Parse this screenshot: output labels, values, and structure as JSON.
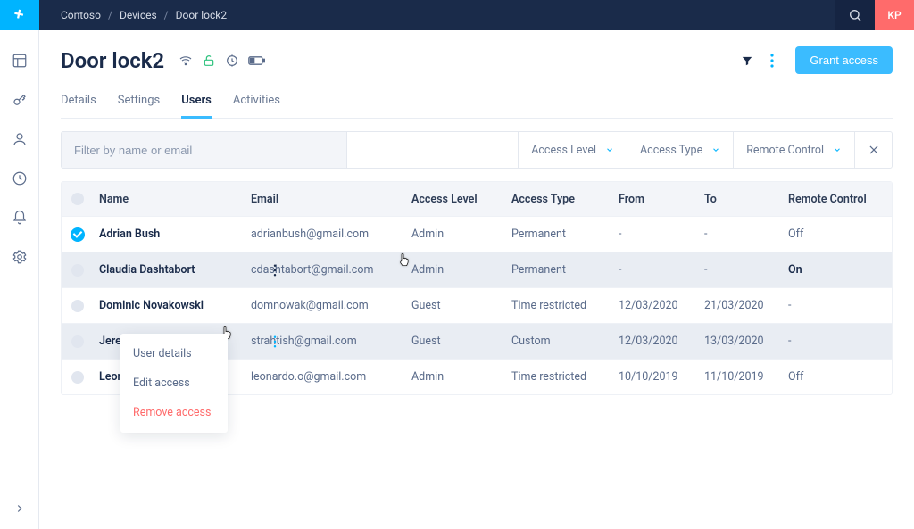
{
  "breadcrumbs": [
    "Contoso",
    "Devices",
    "Door lock2"
  ],
  "user_initials": "KP",
  "page_title": "Door lock2",
  "grant_button": "Grant access",
  "tabs": [
    "Details",
    "Settings",
    "Users",
    "Activities"
  ],
  "active_tab_index": 2,
  "filter": {
    "placeholder": "Filter by name or email",
    "dropdowns": [
      "Access Level",
      "Access Type",
      "Remote Control"
    ]
  },
  "table": {
    "headers": [
      "Name",
      "Email",
      "Access Level",
      "Access Type",
      "From",
      "To",
      "Remote Control"
    ],
    "rows": [
      {
        "checked": true,
        "name": "Adrian Bush",
        "email": "adrianbush@gmail.com",
        "level": "Admin",
        "type": "Permanent",
        "from": "-",
        "to": "-",
        "rc": "Off"
      },
      {
        "checked": false,
        "name": "Claudia Dashtabort",
        "email": "cdashtabort@gmail.com",
        "level": "Admin",
        "type": "Permanent",
        "from": "-",
        "to": "-",
        "rc": "On"
      },
      {
        "checked": false,
        "name": "Dominic Novakowski",
        "email": "domnowak@gmail.com",
        "level": "Guest",
        "type": "Time restricted",
        "from": "12/03/2020",
        "to": "21/03/2020",
        "rc": "-"
      },
      {
        "checked": false,
        "name": "Jeremi Strahtish",
        "email": "strahtish@gmail.com",
        "level": "Guest",
        "type": "Custom",
        "from": "12/03/2020",
        "to": "13/03/2020",
        "rc": "-"
      },
      {
        "checked": false,
        "name": "Leonardo Otabek",
        "email": "leonardo.o@gmail.com",
        "level": "Admin",
        "type": "Time restricted",
        "from": "10/10/2019",
        "to": "11/10/2019",
        "rc": "Off"
      }
    ]
  },
  "context_menu": {
    "items": [
      "User details",
      "Edit access",
      "Remove access"
    ]
  }
}
